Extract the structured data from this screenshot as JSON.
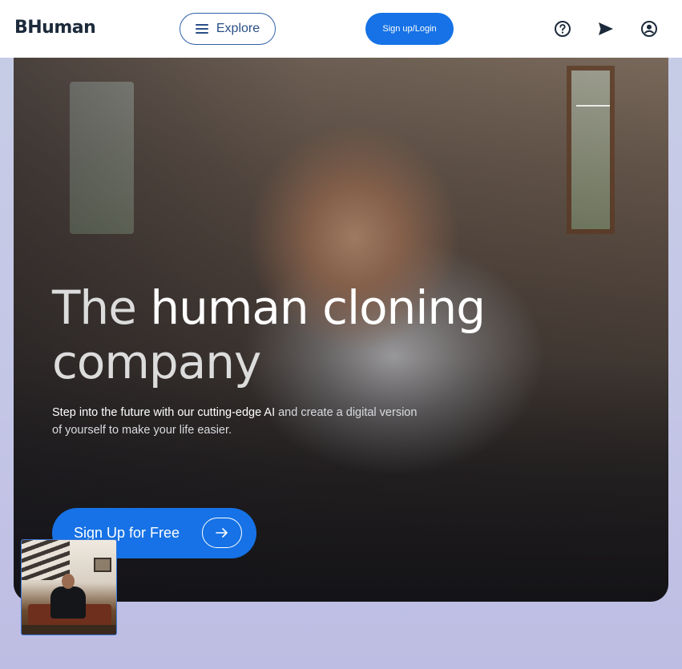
{
  "header": {
    "logo": "BHuman",
    "explore_label": "Explore",
    "signup_login_label": "Sign up/Login",
    "icons": [
      "help-icon",
      "send-icon",
      "account-icon"
    ]
  },
  "hero": {
    "headline_part1": "The ",
    "headline_part2": "human cloning",
    "headline_part3": "company",
    "subtext_part1": "Step into the future with our cutting-edge AI",
    "subtext_part2": " and create a digital version of yourself to make your life easier.",
    "cta_label": "Sign Up for Free"
  },
  "colors": {
    "accent": "#1672e6",
    "logo": "#1c2a3b",
    "explore_border": "#2f5fa8"
  }
}
